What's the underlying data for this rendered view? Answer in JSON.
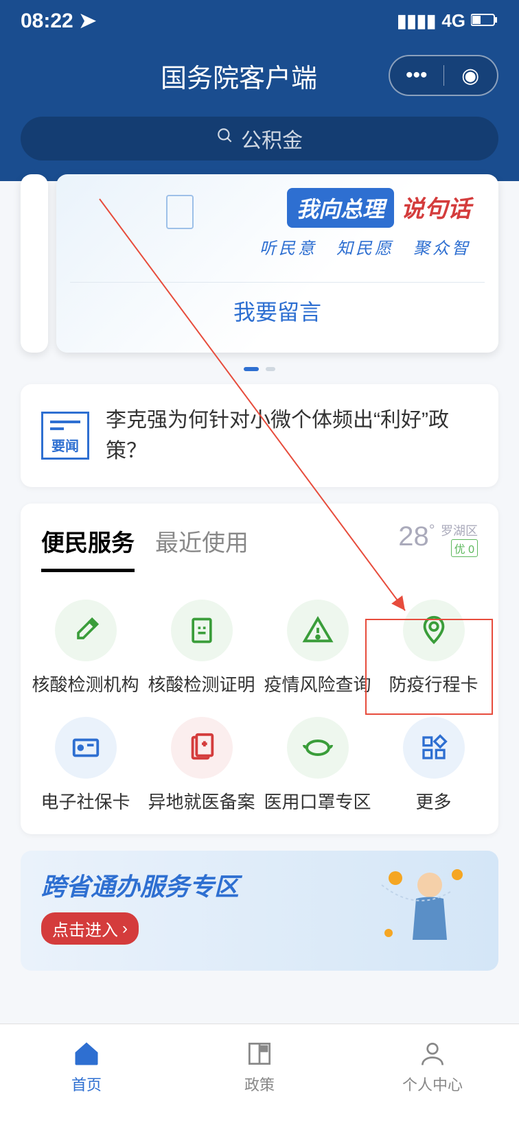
{
  "status": {
    "time": "08:22",
    "network": "4G"
  },
  "header": {
    "title": "国务院客户端"
  },
  "search": {
    "placeholder": "公积金"
  },
  "banner": {
    "chip": "我向总理",
    "say": "说句话",
    "sub": "听民意　知民愿　聚众智",
    "button": "我要留言"
  },
  "news": {
    "badge": "要闻",
    "text": "李克强为何针对小微个体频出“利好”政策？"
  },
  "services": {
    "tab_active": "便民服务",
    "tab_recent": "最近使用",
    "weather": {
      "temp": "28",
      "location": "罗湖区",
      "badge": "优 0"
    },
    "items": [
      {
        "label": "核酸检测机构",
        "icon": "dropper",
        "color": "green"
      },
      {
        "label": "核酸检测证明",
        "icon": "doc-check",
        "color": "green"
      },
      {
        "label": "疫情风险查询",
        "icon": "warning",
        "color": "green"
      },
      {
        "label": "防疫行程卡",
        "icon": "location",
        "color": "green"
      },
      {
        "label": "电子社保卡",
        "icon": "card",
        "color": "blue"
      },
      {
        "label": "异地就医备案",
        "icon": "med-doc",
        "color": "red"
      },
      {
        "label": "医用口罩专区",
        "icon": "mask",
        "color": "green"
      },
      {
        "label": "更多",
        "icon": "more",
        "color": "blue"
      }
    ]
  },
  "promo": {
    "title": "跨省通办服务专区",
    "button": "点击进入"
  },
  "tabs": [
    {
      "label": "首页",
      "active": true
    },
    {
      "label": "政策",
      "active": false
    },
    {
      "label": "个人中心",
      "active": false
    }
  ]
}
